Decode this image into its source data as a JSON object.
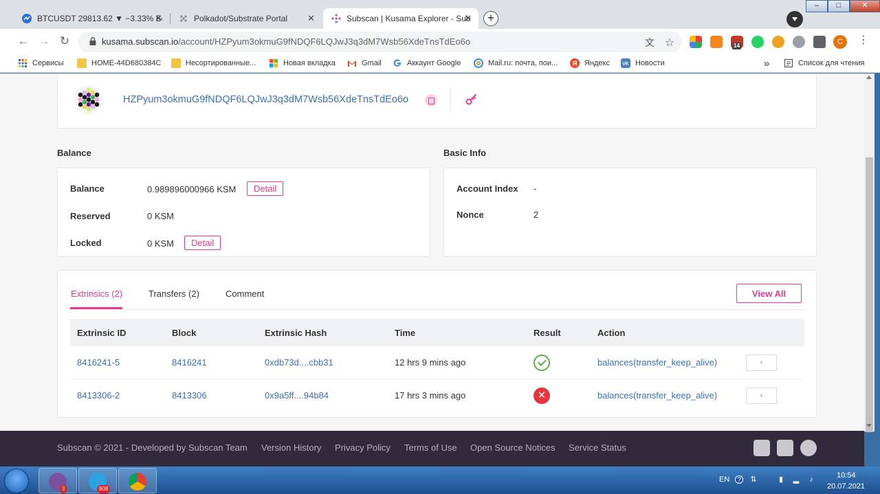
{
  "browser": {
    "tabs": [
      {
        "title": "BTCUSDT 29813.62 ▼ −3.33% Бе",
        "close": "✕"
      },
      {
        "title": "Polkadot/Substrate Portal",
        "close": "✕"
      },
      {
        "title": "Subscan | Kusama Explorer - Sub",
        "close": "✕"
      }
    ],
    "new_tab": "+",
    "window_buttons": {
      "minimize": "–",
      "maximize": "□",
      "close": "✕"
    },
    "nav": {
      "back": "←",
      "forward": "→",
      "reload": "↻"
    },
    "url_host": "kusama.subscan.io",
    "url_path": "/account/HZPyum3okmuG9fNDQF6LQJwJ3q3dM7Wsb56XdeTnsTdEo6o",
    "omnibox_icons": {
      "translate": "文",
      "bookmark_star": "☆"
    },
    "extension_badge": "14",
    "profile_initial": "C",
    "menu": "⋮",
    "bookmarks": [
      {
        "label": "Сервисы",
        "icon": "apps-grid-icon"
      },
      {
        "label": "HOME-44D680384C",
        "icon": "folder-icon"
      },
      {
        "label": "Несортированные...",
        "icon": "folder-icon"
      },
      {
        "label": "Новая вкладка",
        "icon": "microsoft-icon"
      },
      {
        "label": "Gmail",
        "icon": "gmail-icon"
      },
      {
        "label": "Аккаунт Google",
        "icon": "google-icon"
      },
      {
        "label": "Mail.ru: почта, пои...",
        "icon": "mailru-icon"
      },
      {
        "label": "Яндекс",
        "icon": "yandex-icon"
      },
      {
        "label": "Новости",
        "icon": "vk-icon"
      }
    ],
    "bookmarks_overflow": "»",
    "reading_list": "Список для чтения"
  },
  "account": {
    "address": "HZPyum3okmuG9fNDQF6LQJwJ3q3dM7Wsb56XdeTnsTdEo6o"
  },
  "balance": {
    "section_title": "Balance",
    "rows": [
      {
        "label": "Balance",
        "value": "0.989896000966 KSM",
        "action": "Detail"
      },
      {
        "label": "Reserved",
        "value": "0 KSM"
      },
      {
        "label": "Locked",
        "value": "0 KSM",
        "action": "Detail"
      }
    ]
  },
  "basic_info": {
    "section_title": "Basic Info",
    "rows": [
      {
        "label": "Account Index",
        "value": "-"
      },
      {
        "label": "Nonce",
        "value": "2"
      }
    ]
  },
  "tabs": [
    {
      "label": "Extrinsics (2)",
      "active": true
    },
    {
      "label": "Transfers (2)"
    },
    {
      "label": "Comment"
    }
  ],
  "view_all": "View All",
  "table": {
    "columns": [
      "Extrinsic ID",
      "Block",
      "Extrinsic Hash",
      "Time",
      "Result",
      "Action"
    ],
    "rows": [
      {
        "extrinsic_id": "8416241-5",
        "block": "8416241",
        "hash": "0xdb73d....cbb31",
        "time": "12 hrs 9 mins ago",
        "result": "success",
        "action": "balances(transfer_keep_alive)",
        "arrow": "›"
      },
      {
        "extrinsic_id": "8413306-2",
        "block": "8413306",
        "hash": "0x9a5ff....94b84",
        "time": "17 hrs 3 mins ago",
        "result": "failed",
        "action": "balances(transfer_keep_alive)",
        "arrow": "›"
      }
    ],
    "fail_glyph": "✕"
  },
  "footer": {
    "links": [
      "Subscan © 2021 - Developed by Subscan Team",
      "Version History",
      "Privacy Policy",
      "Terms of Use",
      "Open Source Notices",
      "Service Status"
    ]
  },
  "taskbar": {
    "apps": [
      {
        "name": "viber",
        "badge": "3"
      },
      {
        "name": "telegram",
        "badge": "808"
      },
      {
        "name": "chrome",
        "badge": ""
      }
    ],
    "lang": "EN",
    "help": "?",
    "time": "10:54",
    "date": "20.07.2021"
  },
  "colors": {
    "accent": "#e6398f",
    "link": "#3b6ec8",
    "success": "#5aae3a",
    "error": "#e8323c",
    "footer_bg": "#302b3c"
  }
}
